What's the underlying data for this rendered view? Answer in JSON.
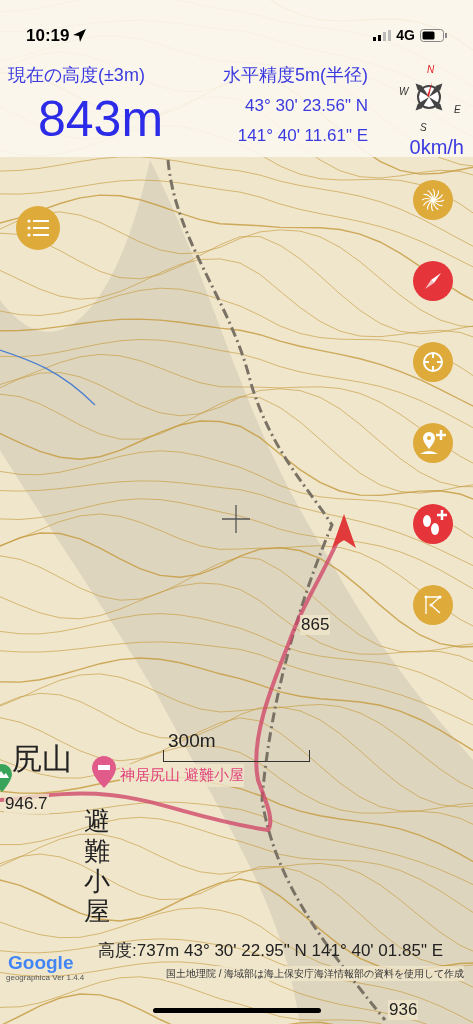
{
  "status_bar": {
    "time": "10:19",
    "network": "4G"
  },
  "header": {
    "altitude_label": "現在の高度(±3m)",
    "altitude": "843m",
    "accuracy_label": "水平精度5m(半径)",
    "latitude": "43° 30' 23.56\" N",
    "longitude": "141° 40' 11.61\" E",
    "speed": "0km/h",
    "compass_labels": [
      "N",
      "W",
      "E",
      "S"
    ]
  },
  "map": {
    "scale": "300m",
    "poi": "神居尻山 避難小屋",
    "labels": [
      {
        "kind": "peak",
        "text": "尻山"
      },
      {
        "kind": "elevation",
        "text": "946.7"
      },
      {
        "kind": "elevation",
        "text": "865"
      },
      {
        "kind": "elevation",
        "text": "936"
      },
      {
        "kind": "vertical",
        "text": "避難小屋"
      }
    ],
    "controls": [
      {
        "kind": "spiral",
        "color": "#deaa3a"
      },
      {
        "kind": "compass",
        "color": "#e5343a"
      },
      {
        "kind": "target",
        "color": "#deaa3a"
      },
      {
        "kind": "add-pin",
        "color": "#deaa3a"
      },
      {
        "kind": "add-steps",
        "color": "#e5343a"
      },
      {
        "kind": "route",
        "color": "#deaa3a"
      }
    ]
  },
  "footer": {
    "cursor_info": "高度:737m  43° 30' 22.95\" N 141° 40' 01.85\" E",
    "google": "Google",
    "version": "geographica Ver 1.4.4",
    "attribution": "国土地理院 / 海域部は海上保安庁海洋情報部の資料を使用して作成"
  }
}
